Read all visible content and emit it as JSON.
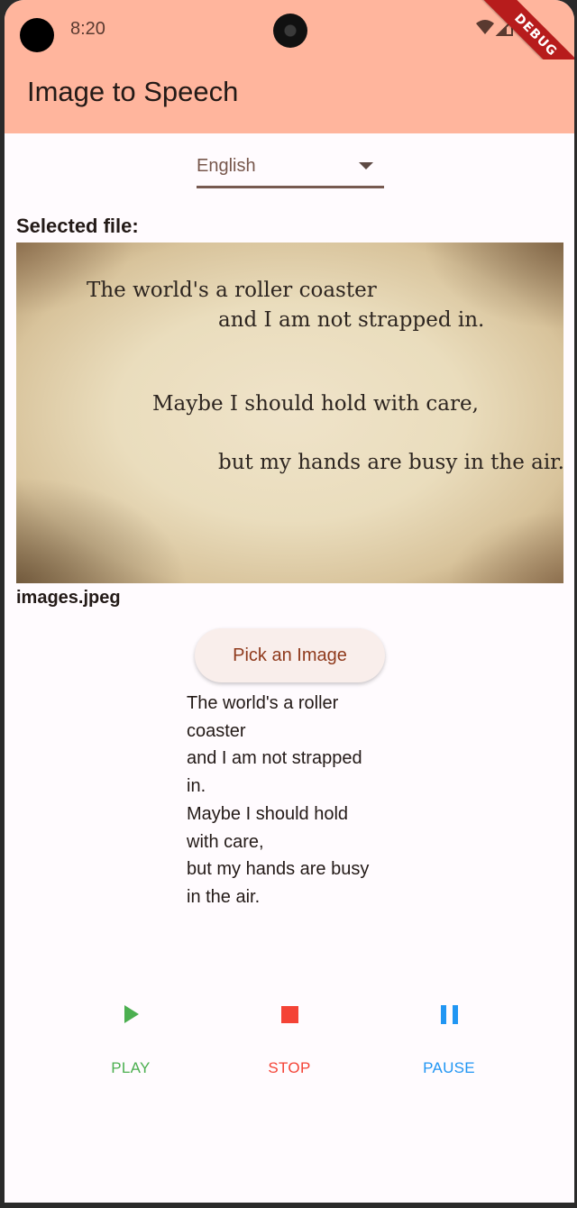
{
  "status_bar": {
    "time": "8:20",
    "icons": [
      "wifi-icon",
      "signal-icon"
    ],
    "debug_banner": "DEBUG"
  },
  "app_bar": {
    "title": "Image to Speech",
    "color": "#ffb59d"
  },
  "language_dropdown": {
    "selected": "English",
    "icon": "dropdown-arrow-icon"
  },
  "selected_file": {
    "label": "Selected file:",
    "filename": "images.jpeg",
    "image_text": [
      "The world's a roller coaster",
      "and I am not strapped in.",
      "Maybe I should hold with care,",
      "but my hands are busy in the air."
    ]
  },
  "pick_button": {
    "label": "Pick an Image"
  },
  "recognized_text": [
    "The world's a roller",
    "coaster",
    "and I am not strapped",
    "in.",
    "Maybe I should hold",
    "with care,",
    "but my hands are busy",
    "in the air."
  ],
  "controls": {
    "play": {
      "label": "PLAY",
      "color": "#4caf50",
      "icon": "play-icon"
    },
    "stop": {
      "label": "STOP",
      "color": "#f44336",
      "icon": "stop-icon"
    },
    "pause": {
      "label": "PAUSE",
      "color": "#2196f3",
      "icon": "pause-icon"
    }
  }
}
